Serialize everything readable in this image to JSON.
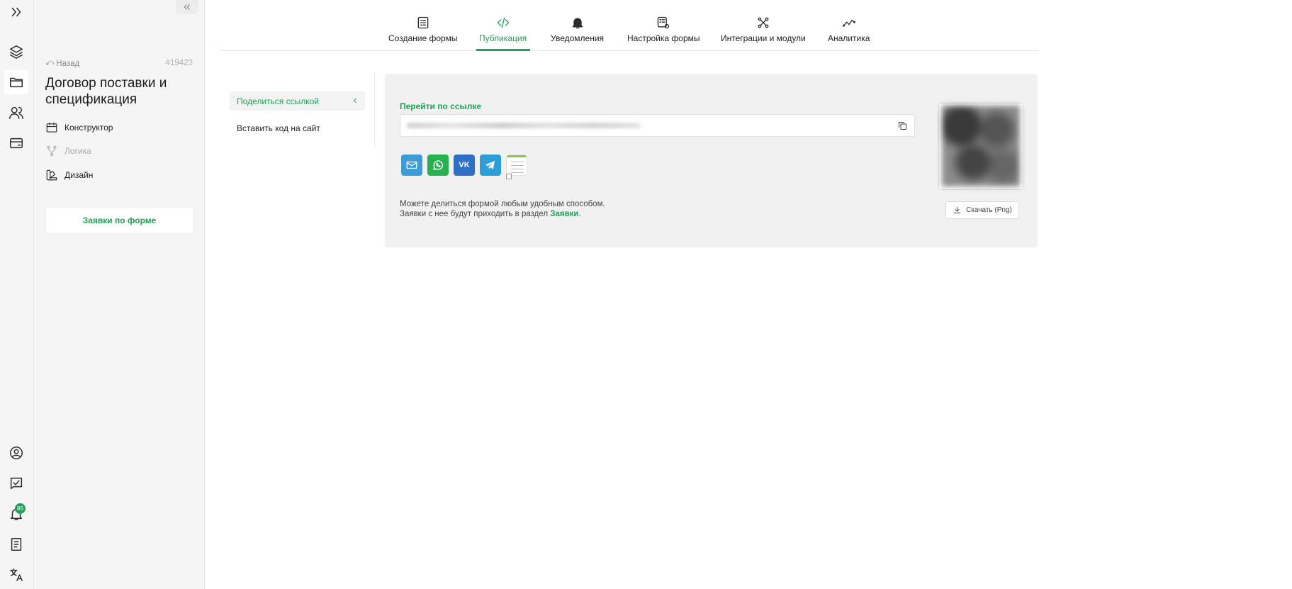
{
  "rail": {
    "notifications_badge": "85",
    "icons": [
      "chevrons-right-icon",
      "layers-icon",
      "folder-icon",
      "users-icon",
      "wallet-icon",
      "user-circle-icon",
      "checklist-icon",
      "bell-icon",
      "book-icon",
      "translate-icon"
    ]
  },
  "sidebar": {
    "back_label": "Назад",
    "form_id": "#19423",
    "form_title": "Договор поставки и спецификация",
    "items": [
      {
        "label": "Конструктор",
        "icon": "calendar-icon"
      },
      {
        "label": "Логика",
        "icon": "branch-icon"
      },
      {
        "label": "Дизайн",
        "icon": "palette-icon"
      }
    ],
    "requests_button": "Заявки по форме"
  },
  "tabs": [
    {
      "label": "Создание формы",
      "icon": "form-list-icon"
    },
    {
      "label": "Публикация",
      "icon": "code-icon"
    },
    {
      "label": "Уведомления",
      "icon": "bell-icon"
    },
    {
      "label": "Настройка формы",
      "icon": "form-settings-icon"
    },
    {
      "label": "Интеграции и модули",
      "icon": "integrations-icon"
    },
    {
      "label": "Аналитика",
      "icon": "analytics-icon"
    }
  ],
  "submenu": [
    {
      "label": "Поделиться ссылкой"
    },
    {
      "label": "Вставить код на сайт"
    }
  ],
  "share": {
    "link_label": "Перейти по ссылке",
    "channels": [
      "email-icon",
      "whatsapp-icon",
      "vk-icon",
      "telegram-icon",
      "sheet-icon"
    ],
    "vk_text": "VK",
    "note_line1": "Можете делиться формой любым удобным способом.",
    "note_line2_prefix": "Заявки с нее будут приходить в раздел ",
    "note_line2_link": "Заявки",
    "note_line2_suffix": ".",
    "download_label": "Скачать (Png)"
  },
  "colors": {
    "accent": "#21a058",
    "panel_bg": "#f1f1f1",
    "sidebar_bg": "#f5f5f5"
  }
}
